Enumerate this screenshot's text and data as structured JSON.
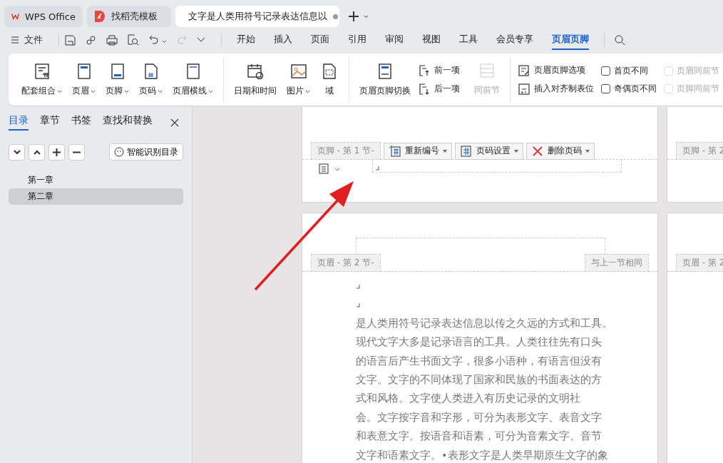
{
  "tabs": [
    {
      "kind": "home",
      "label": "WPS Office",
      "selected": false
    },
    {
      "kind": "template",
      "label": "找稻壳模板",
      "selected": false
    },
    {
      "kind": "doc",
      "label": "文字是人类用符号记录表达信息以",
      "selected": true,
      "modified": true
    }
  ],
  "menu": {
    "file": "文件",
    "tabs": [
      {
        "label": "开始",
        "selected": false
      },
      {
        "label": "插入",
        "selected": false
      },
      {
        "label": "页面",
        "selected": false
      },
      {
        "label": "引用",
        "selected": false
      },
      {
        "label": "审阅",
        "selected": false
      },
      {
        "label": "视图",
        "selected": false
      },
      {
        "label": "工具",
        "selected": false
      },
      {
        "label": "会员专享",
        "selected": false
      },
      {
        "label": "页眉页脚",
        "selected": true
      }
    ]
  },
  "ribbon": {
    "groups": [
      [
        {
          "kind": "combo",
          "label": "配套组合",
          "dropdown": true
        },
        {
          "kind": "header",
          "label": "页眉",
          "dropdown": true
        },
        {
          "kind": "footer",
          "label": "页脚",
          "dropdown": true
        },
        {
          "kind": "pagenum",
          "label": "页码",
          "dropdown": true
        },
        {
          "kind": "headerline",
          "label": "页眉横线",
          "dropdown": true
        }
      ],
      [
        {
          "kind": "datetime",
          "label": "日期和时间",
          "dropdown": false
        },
        {
          "kind": "image",
          "label": "图片",
          "dropdown": true
        },
        {
          "kind": "field",
          "label": "域",
          "dropdown": false
        }
      ],
      [
        {
          "kind": "switch",
          "label": "页眉页脚切换",
          "dropdown": false
        }
      ]
    ],
    "nav": [
      {
        "kind": "prev",
        "label": "前一项"
      },
      {
        "kind": "next",
        "label": "后一项"
      }
    ],
    "same_as_prev": {
      "label": "同前节",
      "disabled": true
    },
    "options": [
      {
        "kind": "options",
        "label": "页眉页脚选项"
      },
      {
        "kind": "tab",
        "label": "插入对齐制表位"
      }
    ],
    "checks": [
      {
        "label": "首页不同",
        "checked": false,
        "disabled": false
      },
      {
        "label": "奇偶页不同",
        "checked": false,
        "disabled": false
      },
      {
        "label": "页眉同前节",
        "checked": false,
        "disabled": true
      },
      {
        "label": "页脚同前节",
        "checked": false,
        "disabled": true
      }
    ]
  },
  "sidebar": {
    "tabs": [
      {
        "label": "目录",
        "selected": true
      },
      {
        "label": "章节",
        "selected": false
      },
      {
        "label": "书签",
        "selected": false
      },
      {
        "label": "查找和替换",
        "selected": false
      }
    ],
    "smart_button": "智能识别目录",
    "items": [
      {
        "label": "第一章",
        "selected": false
      },
      {
        "label": "第二章",
        "selected": true
      }
    ]
  },
  "document": {
    "footer_label": "页脚 - 第 1 节-",
    "footer_tools": [
      {
        "kind": "renumber",
        "label": "重新编号"
      },
      {
        "kind": "settings",
        "label": "页码设置"
      },
      {
        "kind": "delete",
        "label": "删除页码"
      }
    ],
    "header_label": "页眉 - 第 2 节-",
    "same_label": "与上一节相同",
    "right_footer_label": "页脚 - 第 2",
    "right_header_label": "页眉 - 第 2",
    "paragraph": [
      "是人类用符号记录表达信息以传之久远的方式和工具。",
      "现代文字大多是记录语言的工具。人类往往先有口头",
      "的语言后产生书面文字，很多小语种，有语言但没有",
      "文字。文字的不同体现了国家和民族的书面表达的方",
      "式和风格。文字使人类进入有历史记录的文明社",
      "会。文字按字音和字形，可分为表形文字、表音文字",
      "和表意文字。按语音和语素，可分为音素文字、音节",
      "文字和语素文字。•表形文字是人类早期原生文字的象"
    ]
  }
}
